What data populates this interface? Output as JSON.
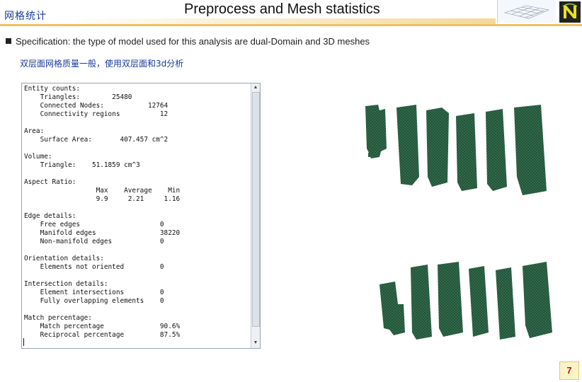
{
  "header": {
    "section_cn": "网格统计",
    "title": "Preprocess and Mesh statistics"
  },
  "spec": "Specification: the type of model used for this analysis are dual-Domain and 3D meshes",
  "subtitle_cn": "双层面网格质量一般，使用双层面和3d分析",
  "console_lines": [
    "Entity counts:",
    "    Triangles:        25480",
    "    Connected Nodes:           12764",
    "    Connectivity regions          12",
    "",
    "Area:",
    "    Surface Area:       407.457 cm^2",
    "",
    "Volume:",
    "    Triangle:    51.1859 cm^3",
    "",
    "Aspect Ratio:",
    "                  Max    Average    Min",
    "                  9.9     2.21     1.16",
    "",
    "Edge details:",
    "    Free edges                    0",
    "    Manifold edges                38220",
    "    Non-manifold edges            0",
    "",
    "Orientation details:",
    "    Elements not oriented         0",
    "",
    "Intersection details:",
    "    Element intersections         0",
    "    Fully overlapping elements    0",
    "",
    "Match percentage:",
    "    Match percentage              90.6%",
    "    Reciprocal percentage         87.5%"
  ],
  "page_number": "7",
  "colors": {
    "mesh": "#2f6b4a",
    "mesh_line": "#1d3a2a",
    "header_bar": "#f0c060",
    "page_number": "#c01010"
  }
}
